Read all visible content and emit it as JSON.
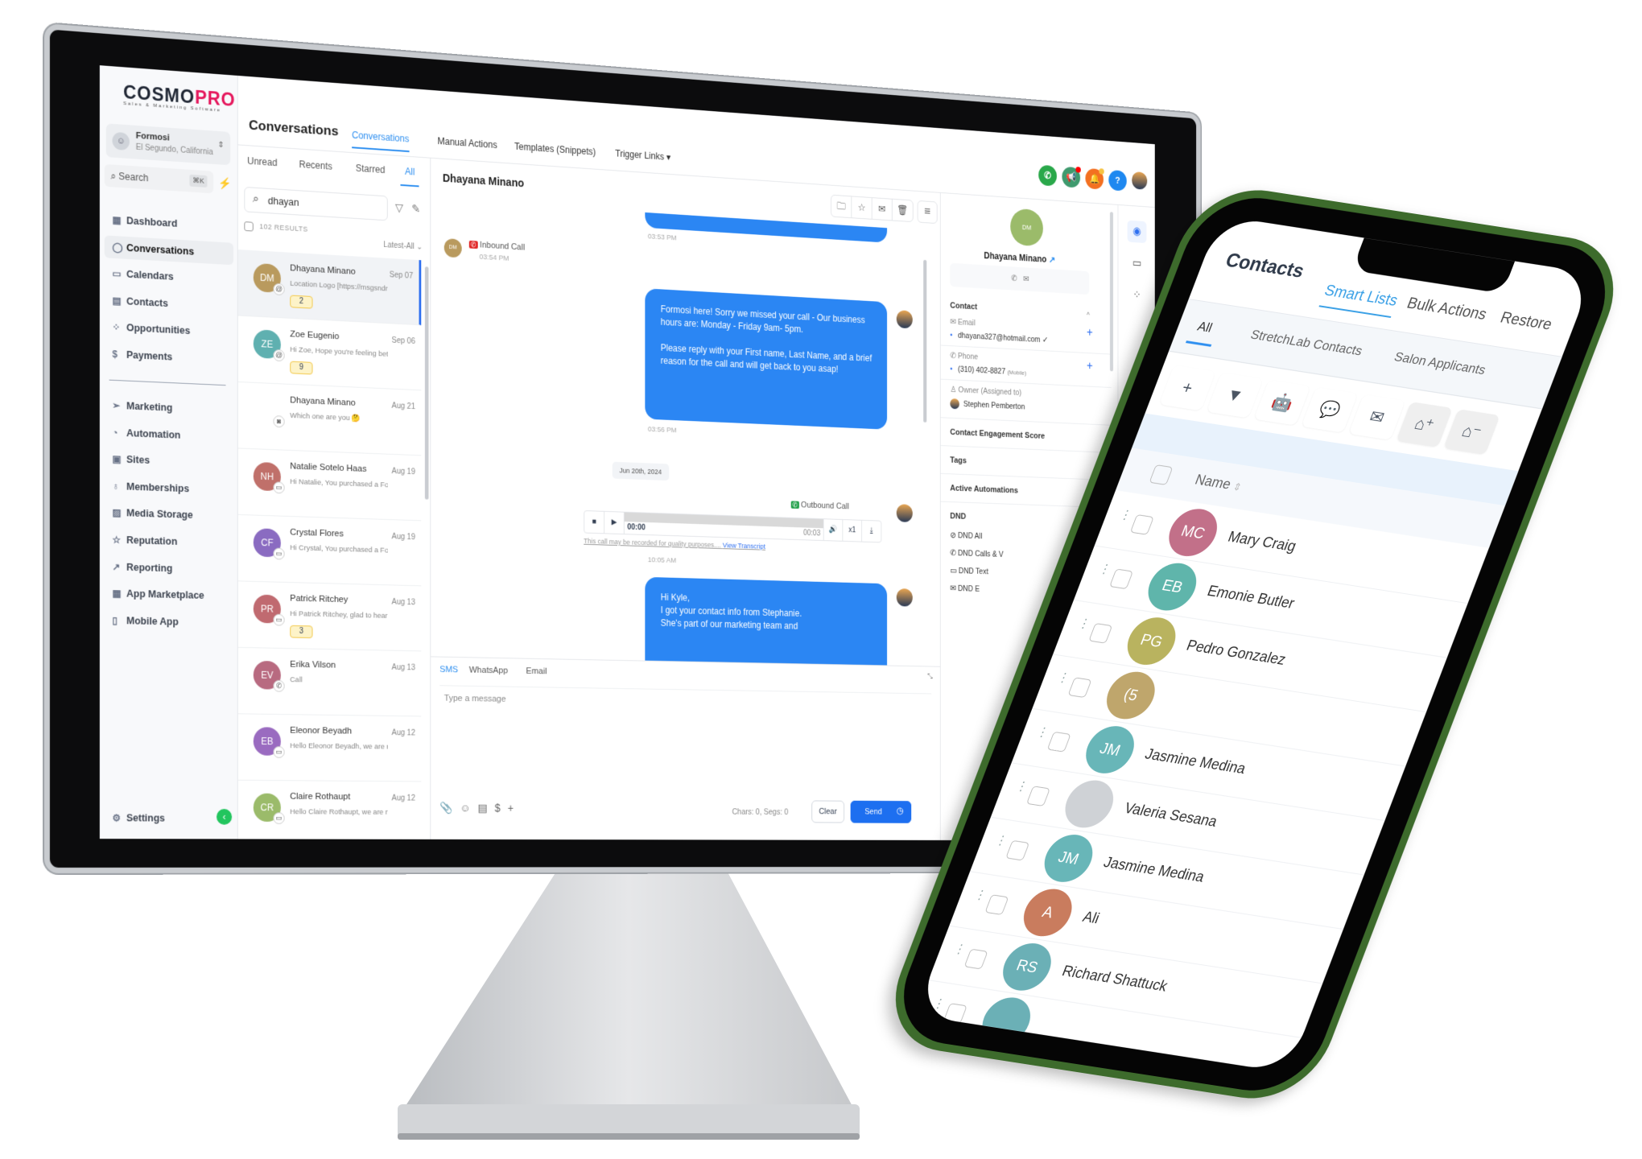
{
  "colors": {
    "accent": "#2e8ff0",
    "bubble": "#2b86f3",
    "brand_pink": "#e5175c",
    "phone_body": "#3d6b2c"
  },
  "logo": {
    "main": "COSMO",
    "accent": "PRO",
    "tagline": "Sales & Marketing Software"
  },
  "account": {
    "name": "Formosi",
    "location": "El Segundo, California"
  },
  "sidebar": {
    "search": "Search",
    "shortcut": "⌘K",
    "items": [
      {
        "label": "Dashboard",
        "icon": "grid-icon",
        "glyph": "▦"
      },
      {
        "label": "Conversations",
        "icon": "chat-icon",
        "glyph": "◯",
        "active": true
      },
      {
        "label": "Calendars",
        "icon": "calendar-icon",
        "glyph": "▭"
      },
      {
        "label": "Contacts",
        "icon": "contacts-icon",
        "glyph": "▤"
      },
      {
        "label": "Opportunities",
        "icon": "opportunities-icon",
        "glyph": "⁘"
      },
      {
        "label": "Payments",
        "icon": "payments-icon",
        "glyph": "$"
      }
    ],
    "items2": [
      {
        "label": "Marketing",
        "icon": "send-icon",
        "glyph": "➢"
      },
      {
        "label": "Automation",
        "icon": "automation-icon",
        "glyph": "◔"
      },
      {
        "label": "Sites",
        "icon": "sites-icon",
        "glyph": "▣"
      },
      {
        "label": "Memberships",
        "icon": "membership-icon",
        "glyph": "♁"
      },
      {
        "label": "Media Storage",
        "icon": "image-icon",
        "glyph": "▨"
      },
      {
        "label": "Reputation",
        "icon": "star-icon",
        "glyph": "☆"
      },
      {
        "label": "Reporting",
        "icon": "chart-icon",
        "glyph": "↗"
      },
      {
        "label": "App Marketplace",
        "icon": "apps-icon",
        "glyph": "▦"
      },
      {
        "label": "Mobile App",
        "icon": "mobile-icon",
        "glyph": "▯"
      }
    ],
    "settings": "Settings"
  },
  "header": {
    "title": "Conversations",
    "tabs": [
      "Conversations",
      "Manual Actions",
      "Templates (Snippets)",
      "Trigger Links ▾"
    ]
  },
  "list": {
    "tabs": [
      "Unread",
      "Recents",
      "Starred",
      "All"
    ],
    "search": "dhayan",
    "results": "102 RESULTS",
    "sort": "Latest-All ⌄",
    "items": [
      {
        "initials": "DM",
        "name": "Dhayana Minano",
        "date": "Sep 07",
        "preview": "Location Logo [https://msgsndr",
        "count": "2",
        "color": "#b99a5e",
        "channel": "@"
      },
      {
        "initials": "ZE",
        "name": "Zoe Eugenio",
        "date": "Sep 06",
        "preview": "Hi Zoe, Hope you're feeling bett",
        "count": "9",
        "color": "#5fb0b0",
        "channel": "@"
      },
      {
        "initials": "",
        "name": "Dhayana Minano",
        "date": "Aug 21",
        "preview": "Which one are you 🤔",
        "color": "#ffffff",
        "channel": "◙"
      },
      {
        "initials": "NH",
        "name": "Natalie Sotelo Haas",
        "date": "Aug 19",
        "preview": "Hi Natalie, You purchased a Fori",
        "color": "#c0706a",
        "channel": "▭"
      },
      {
        "initials": "CF",
        "name": "Crystal Flores",
        "date": "Aug 19",
        "preview": "Hi Crystal, You purchased a Fori",
        "color": "#8a6bc1",
        "channel": "▭"
      },
      {
        "initials": "PR",
        "name": "Patrick Ritchey",
        "date": "Aug 13",
        "preview": "Hi Patrick Ritchey, glad to hear y",
        "count": "3",
        "color": "#c06a70",
        "channel": "▭"
      },
      {
        "initials": "EV",
        "name": "Erika Vilson",
        "date": "Aug 13",
        "preview": "Call",
        "color": "#b86a80",
        "channel": "✆"
      },
      {
        "initials": "EB",
        "name": "Eleonor Beyadh",
        "date": "Aug 12",
        "preview": "Hello Eleonor Beyadh, we are re",
        "color": "#9a6bc0",
        "channel": "▭"
      },
      {
        "initials": "CR",
        "name": "Claire Rothaupt",
        "date": "Aug 12",
        "preview": "Hello Claire Rothaupt, we are rea",
        "color": "#9bbb6a",
        "channel": "▭"
      }
    ]
  },
  "chat": {
    "name": "Dhayana Minano",
    "messages": {
      "t1": "03:53 PM",
      "inbound": "Inbound Call",
      "inbound_time": "03:54 PM",
      "inbound_avatar": "DM",
      "m2": "Formosi here! Sorry we missed your call - Our business hours are:   Monday - Friday 9am- 5pm.\n\nPlease reply with your First name, Last Name, and a brief reason for the call and will get back to you asap!",
      "t2": "03:56 PM",
      "date": "Jun 20th, 2024",
      "outbound": "Outbound Call",
      "pos": "00:00",
      "dur": "00:03",
      "speed": "x1",
      "disclaimer": "This call may be recorded for quality purposes....",
      "transcript": "View Transcript",
      "t3": "10:05 AM",
      "m3": "Hi Kyle,\nI got your contact info from Stephanie.\nShe's part of our marketing team and"
    },
    "composer": {
      "tabs": [
        "SMS",
        "WhatsApp",
        "Email"
      ],
      "placeholder": "Type a message",
      "counter": "Chars: 0, Segs: 0",
      "clear": "Clear",
      "send": "Send"
    }
  },
  "contact": {
    "initials": "DM",
    "name": "Dhayana Minano",
    "section": "Contact",
    "email_label": "Email",
    "email": "dhayana327@hotmail.com ✓",
    "phone_label": "Phone",
    "phone": "(310) 402-8827",
    "phone_type": "(Mobile)",
    "owner_label": "Owner (Assigned to)",
    "owner": "Stephen Pemberton",
    "sections": [
      "Contact Engagement Score",
      "Tags",
      "Active Automations",
      "DND"
    ],
    "dnd": [
      "DND All",
      "DND Calls & V",
      "DND Text",
      "DND E"
    ]
  },
  "phone": {
    "title": "Contacts",
    "tabs": [
      "Smart Lists",
      "Bulk Actions",
      "Restore"
    ],
    "lists": [
      "All",
      "StretchLab Contacts",
      "Salon Applicants"
    ],
    "name_header": "Name",
    "rows": [
      {
        "initials": "MC",
        "name": "Mary Craig",
        "color": "#c27089"
      },
      {
        "initials": "EB",
        "name": "Emonie Butler",
        "color": "#5fb5ab"
      },
      {
        "initials": "PG",
        "name": "Pedro Gonzalez",
        "color": "#b9b35f"
      },
      {
        "initials": "(5",
        "name": "",
        "color": "#bfa66c"
      },
      {
        "initials": "JM",
        "name": "Jasmine Medina",
        "color": "#68b6b8"
      },
      {
        "initials": "",
        "name": "Valeria Sesana",
        "color": "#cfd2d6"
      },
      {
        "initials": "JM",
        "name": "Jasmine Medina",
        "color": "#68b6b8"
      },
      {
        "initials": "A",
        "name": "Ali",
        "color": "#c97c5e"
      },
      {
        "initials": "RS",
        "name": "Richard Shattuck",
        "color": "#6bb0b6"
      },
      {
        "initials": "",
        "name": "",
        "color": "#6bb0b6"
      }
    ]
  }
}
